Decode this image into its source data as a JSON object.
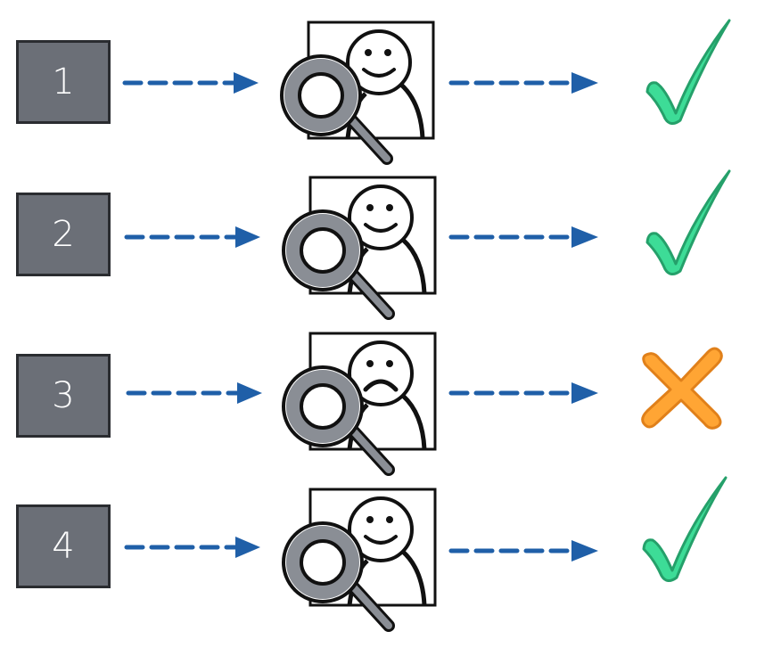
{
  "colors": {
    "box_fill": "#6b6f77",
    "box_border": "#2a2c30",
    "arrow": "#1f5fa8",
    "check_fill": "#3ddc97",
    "check_stroke": "#25a06a",
    "cross_fill": "#ffa534",
    "cross_stroke": "#e0801a",
    "magnifier_fill": "#8a8e95"
  },
  "steps": [
    {
      "number": "1",
      "face": "happy",
      "result": "check-icon"
    },
    {
      "number": "2",
      "face": "happy",
      "result": "check-icon"
    },
    {
      "number": "3",
      "face": "sad",
      "result": "cross-icon"
    },
    {
      "number": "4",
      "face": "happy",
      "result": "check-icon"
    }
  ]
}
